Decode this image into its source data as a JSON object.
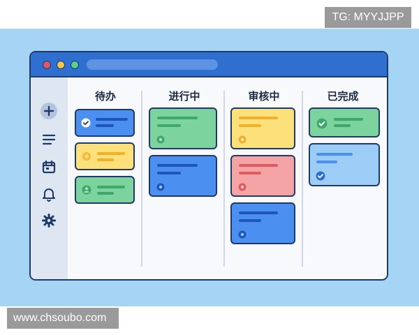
{
  "watermarks": {
    "top": "TG: MYYJJPP",
    "bottom": "www.chsoubo.com"
  },
  "colors": {
    "backdrop": "#a6d4f5",
    "titlebar": "#2f6fd0",
    "blue_card": "#4b8ff0",
    "yellow_card": "#fce07a",
    "green_card": "#7dd39d",
    "red_card": "#f4a4a4",
    "light_blue_card": "#9ccdf7"
  },
  "window": {
    "traffic_lights": [
      "#e0566a",
      "#f5c74a",
      "#5fcf8c"
    ]
  },
  "sidebar": {
    "icons": [
      "plus-icon",
      "list-icon",
      "calendar-icon",
      "bell-icon",
      "gear-icon"
    ]
  },
  "board": {
    "columns": [
      {
        "title": "待办",
        "cards": [
          {
            "color": "blue",
            "icon": "check-circle-icon"
          },
          {
            "color": "yellow",
            "icon": "circle-icon"
          },
          {
            "color": "green",
            "icon": "user-icon"
          }
        ]
      },
      {
        "title": "进行中",
        "cards": [
          {
            "color": "green",
            "icon": "dot-icon"
          },
          {
            "color": "blue",
            "icon": "dot-icon"
          }
        ]
      },
      {
        "title": "审核中",
        "cards": [
          {
            "color": "yellow",
            "icon": "dot-icon"
          },
          {
            "color": "red",
            "icon": "dot-icon"
          },
          {
            "color": "blue",
            "icon": "dot-icon"
          }
        ]
      },
      {
        "title": "已完成",
        "cards": [
          {
            "color": "green",
            "icon": "check-circle-icon"
          },
          {
            "color": "light-blue",
            "icon": "check-circle-icon"
          }
        ]
      }
    ]
  }
}
